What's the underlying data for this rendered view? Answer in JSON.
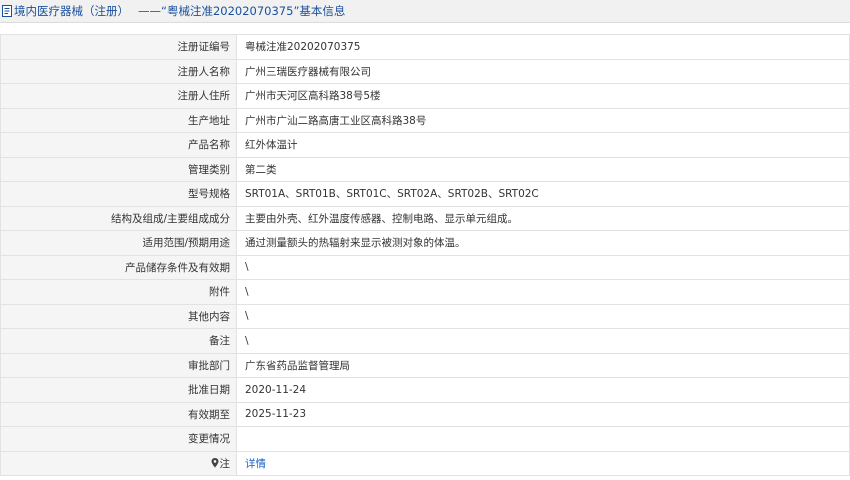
{
  "header": {
    "category": "境内医疗器械（注册）",
    "separator": "——",
    "title": "“粤械注准20202070375”基本信息"
  },
  "rows": [
    {
      "label": "注册证编号",
      "value": "粤械注准20202070375"
    },
    {
      "label": "注册人名称",
      "value": "广州三瑞医疗器械有限公司"
    },
    {
      "label": "注册人住所",
      "value": "广州市天河区高科路38号5楼"
    },
    {
      "label": "生产地址",
      "value": "广州市广汕二路高唐工业区高科路38号"
    },
    {
      "label": "产品名称",
      "value": "红外体温计"
    },
    {
      "label": "管理类别",
      "value": "第二类"
    },
    {
      "label": "型号规格",
      "value": "SRT01A、SRT01B、SRT01C、SRT02A、SRT02B、SRT02C"
    },
    {
      "label": "结构及组成/主要组成成分",
      "value": "主要由外壳、红外温度传感器、控制电路、显示单元组成。"
    },
    {
      "label": "适用范围/预期用途",
      "value": "通过测量额头的热辐射来显示被测对象的体温。"
    },
    {
      "label": "产品储存条件及有效期",
      "value": "\\"
    },
    {
      "label": "附件",
      "value": "\\"
    },
    {
      "label": "其他内容",
      "value": "\\"
    },
    {
      "label": "备注",
      "value": "\\"
    },
    {
      "label": "审批部门",
      "value": "广东省药品监督管理局"
    },
    {
      "label": "批准日期",
      "value": "2020-11-24"
    },
    {
      "label": "有效期至",
      "value": "2025-11-23"
    },
    {
      "label": "变更情况",
      "value": ""
    }
  ],
  "note_row": {
    "label": "注",
    "link_text": "详情",
    "icon": "map-pin-icon"
  },
  "colors": {
    "link": "#1a62c9",
    "header_text": "#1a4f9e",
    "label_bg": "#f5f5f5",
    "border": "#e2e2e2"
  }
}
